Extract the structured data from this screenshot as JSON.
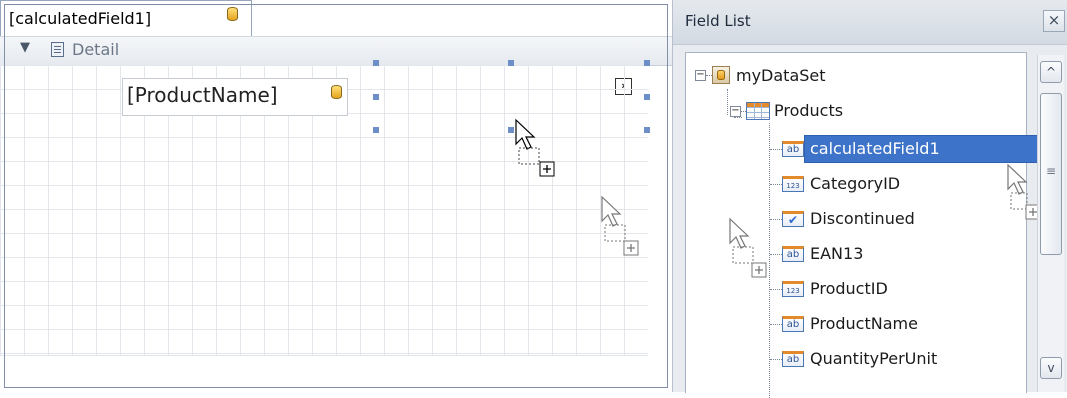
{
  "designer": {
    "band": {
      "toggle": "▼",
      "label": "Detail"
    },
    "controls": {
      "product_name": "[ProductName]",
      "calculated_field": "[calculatedField1]"
    },
    "smart_tag": "›"
  },
  "field_list": {
    "title": "Field List",
    "close": "×",
    "root": {
      "expander": "−",
      "label": "myDataSet"
    },
    "table": {
      "expander": "−",
      "label": "Products"
    },
    "fields": [
      {
        "label": "calculatedField1",
        "type": "string",
        "icon": "ab",
        "selected": true
      },
      {
        "label": "CategoryID",
        "type": "number",
        "icon": "123"
      },
      {
        "label": "Discontinued",
        "type": "boolean",
        "icon": "✔"
      },
      {
        "label": "EAN13",
        "type": "string",
        "icon": "ab"
      },
      {
        "label": "ProductID",
        "type": "number",
        "icon": "123"
      },
      {
        "label": "ProductName",
        "type": "string",
        "icon": "ab"
      },
      {
        "label": "QuantityPerUnit",
        "type": "string",
        "icon": "ab"
      }
    ],
    "scrollbar": {
      "up": "^",
      "down": "v",
      "thumb_grip": "≡"
    }
  },
  "colors": {
    "selection": "#3d73c8",
    "accent_orange": "#e38a2b",
    "handle": "#6c8fc8"
  }
}
